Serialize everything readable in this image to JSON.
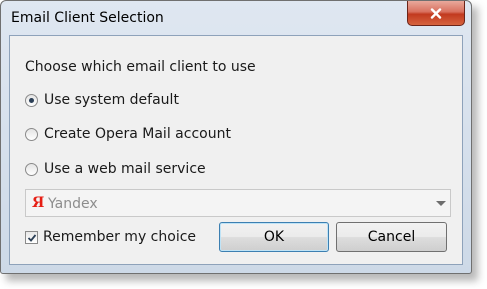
{
  "window": {
    "title": "Email Client Selection"
  },
  "dialog": {
    "heading": "Choose which email client to use",
    "options": [
      {
        "label": "Use system default",
        "selected": true
      },
      {
        "label": "Create Opera Mail account",
        "selected": false
      },
      {
        "label": "Use a web mail service",
        "selected": false
      }
    ],
    "web_mail_service": {
      "selected_value": "Yandex",
      "icon": "yandex-icon",
      "disabled": true
    },
    "remember": {
      "label": "Remember my choice",
      "checked": true
    },
    "buttons": {
      "ok": "OK",
      "cancel": "Cancel"
    }
  },
  "colors": {
    "close_button": "#c23a1f",
    "yandex": "#e61e14"
  }
}
